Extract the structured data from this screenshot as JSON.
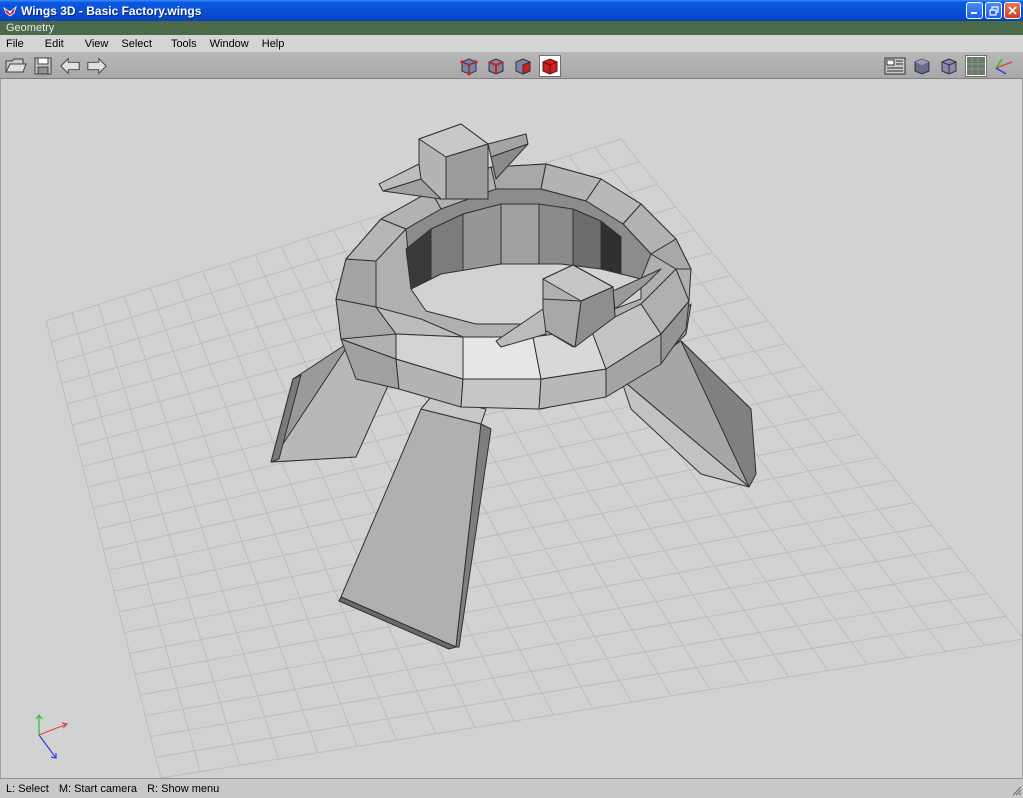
{
  "window": {
    "title": "Wings 3D - Basic Factory.wings"
  },
  "geometry_bar": {
    "label": "Geometry"
  },
  "menu": {
    "items": [
      "File",
      "Edit",
      "View",
      "Select",
      "Tools",
      "Window",
      "Help"
    ]
  },
  "toolbar": {
    "left_icons": [
      "open-folder-icon",
      "save-disk-icon",
      "undo-arrow-icon",
      "redo-arrow-icon"
    ],
    "selection_modes": [
      "vertex-mode-icon",
      "edge-mode-icon",
      "face-mode-icon",
      "body-mode-icon"
    ],
    "active_selection_mode": "body-mode-icon",
    "right_icons": [
      "orthographic-view-icon",
      "smooth-shading-icon",
      "wireframe-shading-icon",
      "groundplane-toggle-icon",
      "axes-toggle-icon"
    ]
  },
  "status": {
    "items": [
      "L: Select",
      "M: Start camera",
      "R: Show menu"
    ]
  },
  "colors": {
    "titlebar": "#0a4fd6",
    "selected_mode": "#cc2020",
    "viewport_bg": "#d2d2d2",
    "grid": "#bcbcbc",
    "axis_x": "#e04040",
    "axis_y": "#30c030",
    "axis_z": "#3040e0"
  }
}
